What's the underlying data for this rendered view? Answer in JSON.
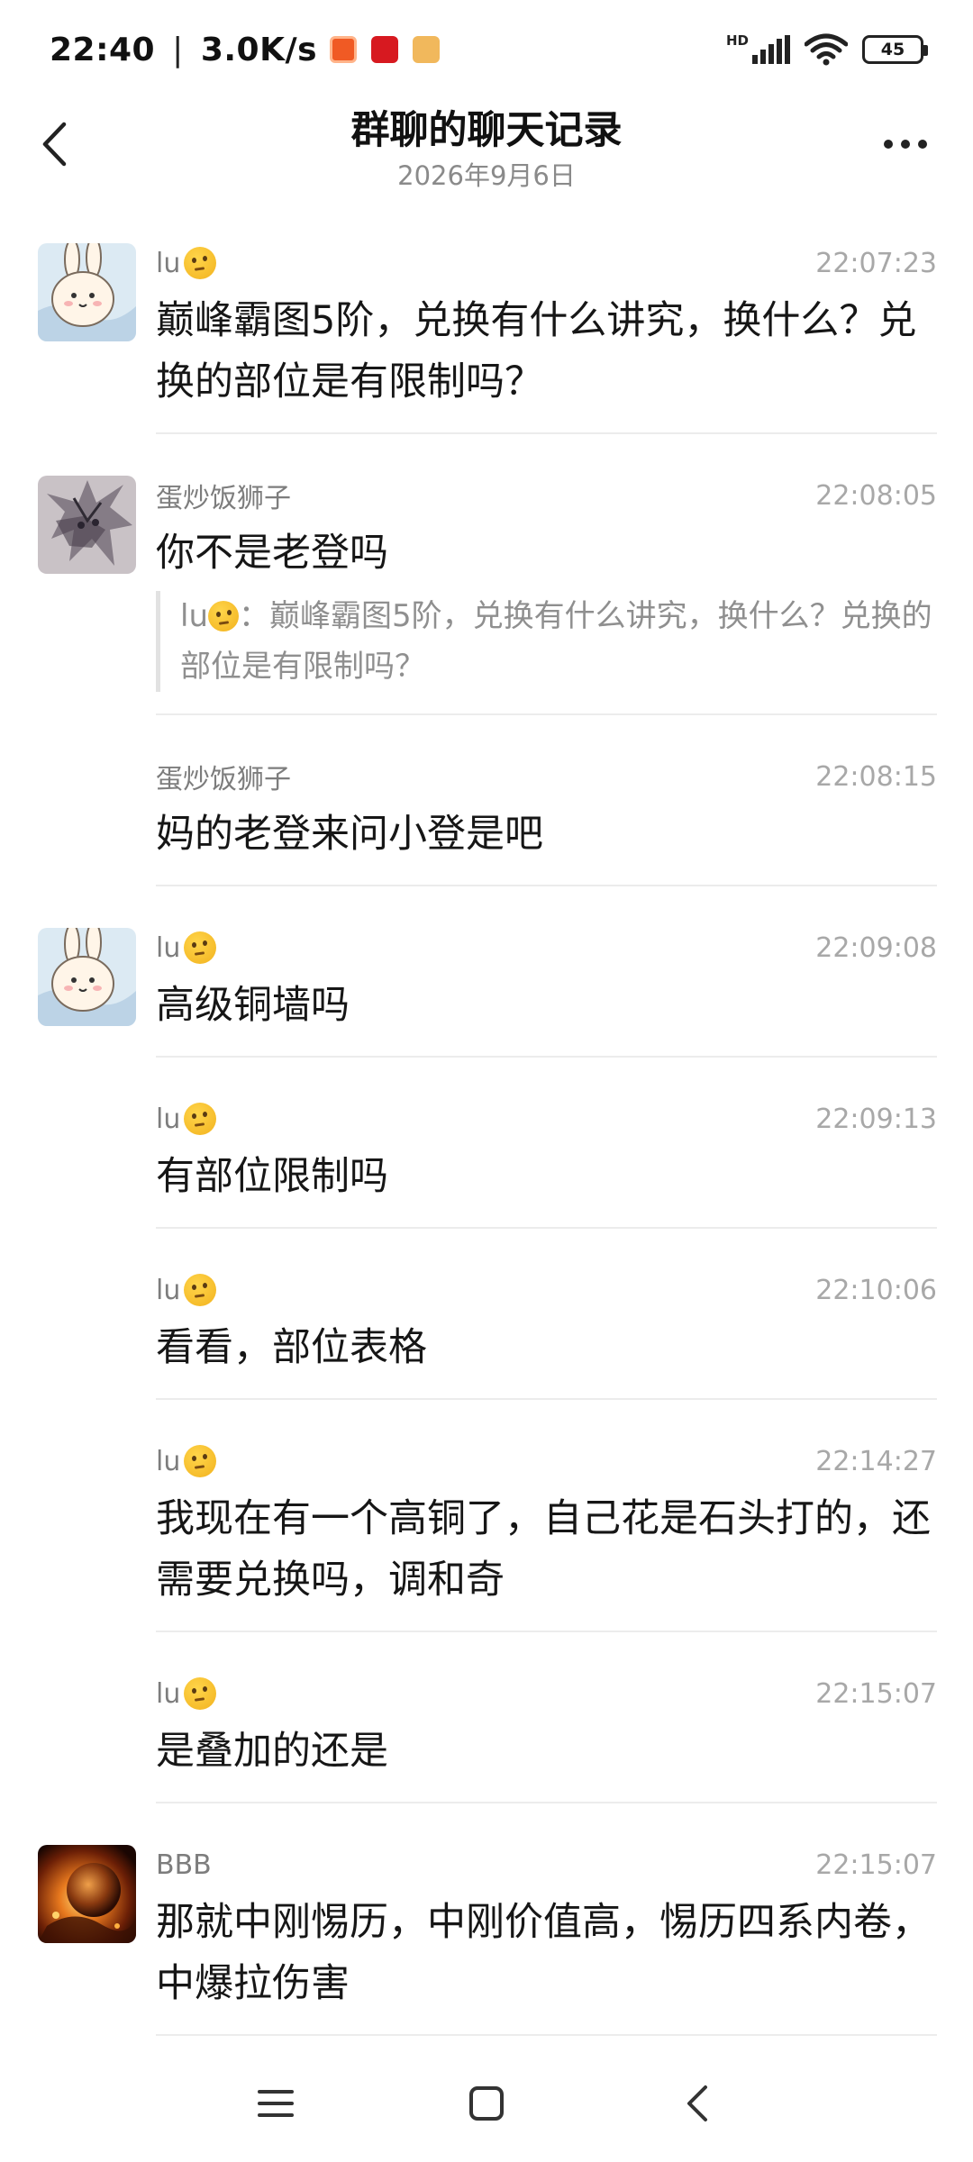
{
  "status_bar": {
    "time": "22:40",
    "net_speed": "3.0K/s",
    "network_badge": "HD",
    "battery": "45"
  },
  "header": {
    "title": "群聊的聊天记录",
    "date": "2026年9月6日"
  },
  "messages": [
    {
      "sender": "lu",
      "time": "22:07:23",
      "text": "巅峰霸图5阶，兑换有什么讲究，换什么？兑换的部位是有限制吗？",
      "avatar": "bunny"
    },
    {
      "sender": "蛋炒饭狮子",
      "time": "22:08:05",
      "text": "你不是老登吗",
      "avatar": "lion",
      "quote": {
        "sender": "lu",
        "text": "巅峰霸图5阶，兑换有什么讲究，换什么？兑换的部位是有限制吗？"
      }
    },
    {
      "sender": "蛋炒饭狮子",
      "time": "22:08:15",
      "text": "妈的老登来问小登是吧"
    },
    {
      "sender": "lu",
      "time": "22:09:08",
      "text": "高级铜墙吗",
      "avatar": "bunny"
    },
    {
      "sender": "lu",
      "time": "22:09:13",
      "text": "有部位限制吗"
    },
    {
      "sender": "lu",
      "time": "22:10:06",
      "text": "看看，部位表格"
    },
    {
      "sender": "lu",
      "time": "22:14:27",
      "text": "我现在有一个高铜了，自己花是石头打的，还需要兑换吗，调和奇"
    },
    {
      "sender": "lu",
      "time": "22:15:07",
      "text": "是叠加的还是"
    },
    {
      "sender": "BBB",
      "time": "22:15:07",
      "text": "那就中刚惕历，中刚价值高，惕历四系内卷，中爆拉伤害",
      "avatar": "planet"
    }
  ],
  "colors": {
    "text": "#161616",
    "meta": "#a8a8a8",
    "divider": "#ececec"
  }
}
